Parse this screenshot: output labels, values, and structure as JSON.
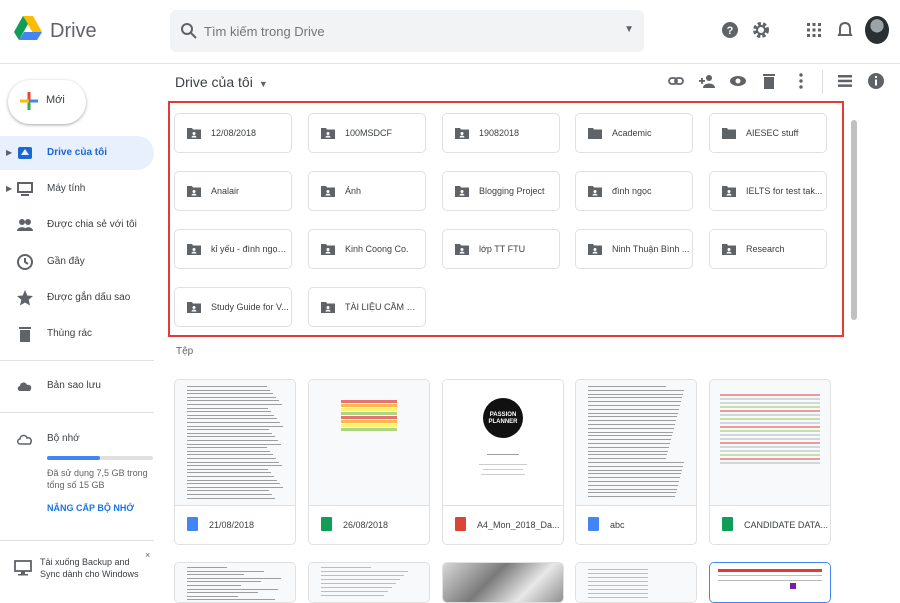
{
  "app": {
    "title": "Drive"
  },
  "search": {
    "placeholder": "Tìm kiếm trong Drive"
  },
  "new_button": {
    "label": "Mới"
  },
  "sidebar": {
    "items": [
      {
        "label": "Drive của tôi",
        "icon": "drive-icon"
      },
      {
        "label": "Máy tính",
        "icon": "computer-icon"
      },
      {
        "label": "Được chia sẻ với tôi",
        "icon": "shared-people-icon"
      },
      {
        "label": "Gần đây",
        "icon": "clock-icon"
      },
      {
        "label": "Được gắn dấu sao",
        "icon": "star-icon"
      },
      {
        "label": "Thùng rác",
        "icon": "trash-icon"
      },
      {
        "label": "Bản sao lưu",
        "icon": "cloud-icon"
      },
      {
        "label": "Bộ nhớ",
        "icon": "cloud-outline-icon"
      }
    ],
    "storage": {
      "used_fraction": 0.5,
      "text": "Đã sử dụng 7,5 GB trong tổng số 15 GB",
      "upgrade": "NÂNG CẤP BỘ NHỚ"
    },
    "backup": {
      "text": "Tải xuống Backup and Sync dành cho Windows",
      "close": "×"
    }
  },
  "main": {
    "title": "Drive của tôi",
    "files_label": "Tệp",
    "folders": [
      "12/08/2018",
      "100MSDCF",
      "19082018",
      "Academic",
      "AIESEC stuff",
      "Analair",
      "Ảnh",
      "Blogging Project",
      "đình ngọc",
      "IELTS for test tak...",
      "kỉ yếu - đình ngọc...",
      "Kinh Coong Co.",
      "lớp TT FTU",
      "Ninh Thuận Bình ...",
      "Research",
      "Study Guide for V...",
      "TÀI LIỆU CẦM ƠN..."
    ],
    "files": [
      {
        "name": "21/08/2018",
        "type": "doc",
        "color": "#4285f4"
      },
      {
        "name": "26/08/2018",
        "type": "sheet",
        "color": "#0f9d58"
      },
      {
        "name": "A4_Mon_2018_Da...",
        "type": "pdf",
        "color": "#db4437"
      },
      {
        "name": "abc",
        "type": "doc",
        "color": "#4285f4"
      },
      {
        "name": "CANDIDATE DATA...",
        "type": "sheet",
        "color": "#0f9d58"
      }
    ],
    "planner_text": "PASSION PLANNER"
  },
  "colors": {
    "accent": "#1a73e8",
    "highlight": "#e53935"
  }
}
